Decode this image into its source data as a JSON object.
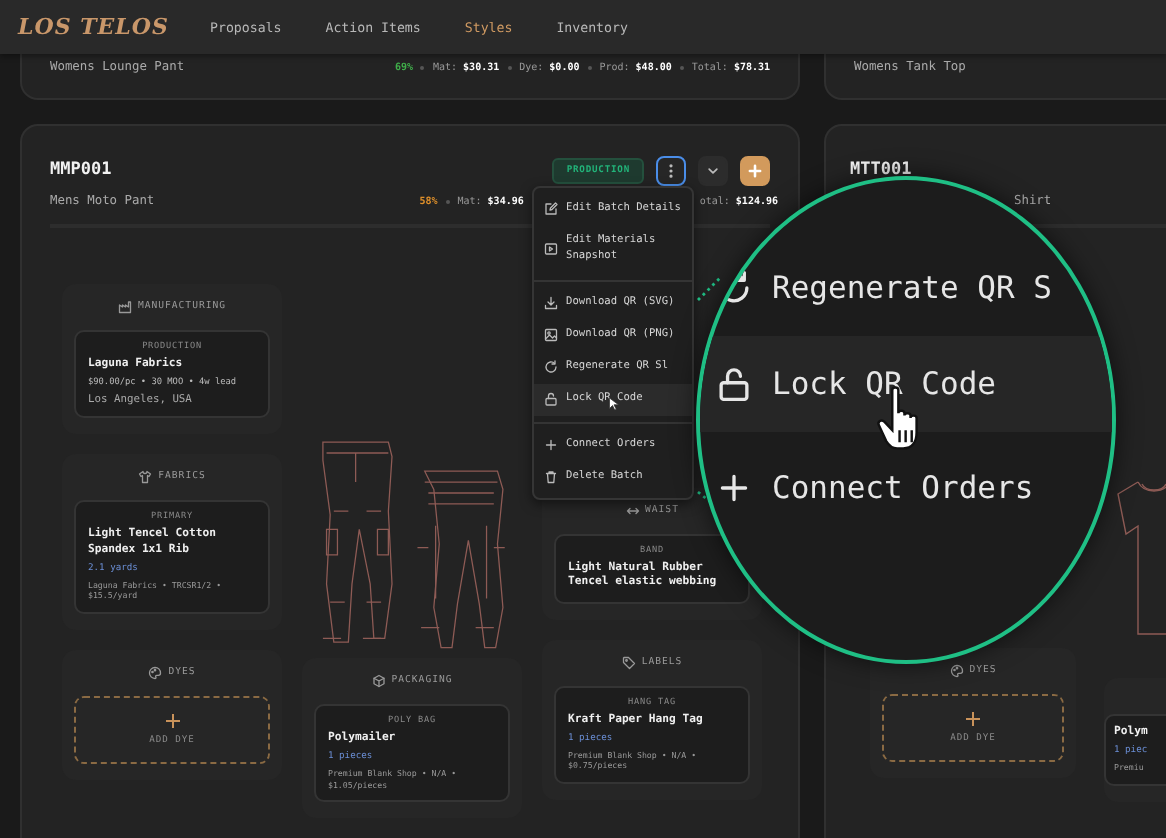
{
  "nav": {
    "logo": "LOS TELOS",
    "items": [
      {
        "label": "Proposals",
        "selected": false
      },
      {
        "label": "Action Items",
        "selected": false
      },
      {
        "label": "Styles",
        "selected": true
      },
      {
        "label": "Inventory",
        "selected": false
      }
    ]
  },
  "top_cards": [
    {
      "name": "Womens Lounge Pant",
      "margin": {
        "text": "69%",
        "color": "#3fae4a"
      },
      "stats": [
        {
          "label": "Mat:",
          "value": "$30.31"
        },
        {
          "label": "Dye:",
          "value": "$0.00"
        },
        {
          "label": "Prod:",
          "value": "$48.00"
        },
        {
          "label": "Total:",
          "value": "$78.31"
        }
      ]
    },
    {
      "name": "Womens Tank Top"
    }
  ],
  "batch_card": {
    "code": "MMP001",
    "name": "Mens Moto Pant",
    "status": "PRODUCTION",
    "menu_open": true,
    "margin": {
      "text": "58%",
      "color": "#e0902a"
    },
    "stats": [
      {
        "label": "Mat:",
        "value": "$34.96"
      }
    ],
    "stats_right": [
      {
        "label": "otal:",
        "value": "$124.96"
      }
    ],
    "columns": [
      [
        {
          "kind": "manufacturing",
          "title": "MANUFACTURING",
          "items": [
            {
              "label": "PRODUCTION",
              "title": "Laguna Fabrics",
              "lines": [
                "$90.00/pc • 30 MOO • 4w lead",
                "Los Angeles, USA"
              ]
            }
          ]
        },
        {
          "kind": "fabrics",
          "title": "FABRICS",
          "items": [
            {
              "label": "PRIMARY",
              "title": "Light Tencel Cotton Spandex 1x1 Rib",
              "qty": "2.1 yards",
              "meta": "Laguna Fabrics • TRCSR1/2 • $15.5/yard"
            }
          ]
        },
        {
          "kind": "dyes",
          "title": "DYES",
          "action": "ADD DYE"
        }
      ],
      [
        {
          "kind": "pants"
        },
        {
          "kind": "packaging",
          "title": "PACKAGING",
          "items": [
            {
              "label": "POLY BAG",
              "title": "Polymailer",
              "qty": "1 pieces",
              "meta": "Premium Blank Shop • N/A • $1.05/pieces"
            }
          ]
        }
      ],
      [
        {
          "kind": "waist",
          "title": "WAIST",
          "items": [
            {
              "label": "BAND",
              "title": "Light Natural Rubber Tencel elastic webbing"
            }
          ]
        },
        {
          "kind": "labels",
          "title": "LABELS",
          "items": [
            {
              "label": "HANG TAG",
              "title": "Kraft Paper Hang Tag",
              "qty": "1 pieces",
              "meta": "Premium Blank Shop • N/A • $0.75/pieces"
            }
          ]
        }
      ]
    ]
  },
  "side_card": {
    "code": "MTT001",
    "name": "Shirt",
    "dyes": {
      "title": "DYES",
      "action": "ADD DYE"
    },
    "packaging": {
      "title": "Polym",
      "qty": "1 piec",
      "meta": "Premiu"
    }
  },
  "menu": {
    "groups": [
      [
        {
          "kind": "edit",
          "label": "Edit Batch Details",
          "hovered": false
        },
        {
          "kind": "snapshot",
          "label": "Edit Materials Snapshot",
          "hovered": false
        }
      ],
      [
        {
          "kind": "download",
          "label": "Download QR (SVG)",
          "hovered": false
        },
        {
          "kind": "image",
          "label": "Download QR (PNG)",
          "hovered": false
        },
        {
          "kind": "regenerate",
          "label": "Regenerate QR Sl",
          "hovered": false
        },
        {
          "kind": "lock",
          "label": "Lock QR Code",
          "hovered": true
        }
      ],
      [
        {
          "kind": "add",
          "label": "Connect Orders",
          "hovered": false
        },
        {
          "kind": "delete",
          "label": "Delete Batch",
          "hovered": false
        }
      ]
    ]
  },
  "magnifier": {
    "items": [
      {
        "kind": "regenerate",
        "label": "Regenerate QR S",
        "hovered": false
      },
      {
        "kind": "lock",
        "label": "Lock QR Code",
        "hovered": true
      },
      {
        "kind": "add",
        "label": "Connect Orders",
        "hovered": false
      }
    ]
  }
}
